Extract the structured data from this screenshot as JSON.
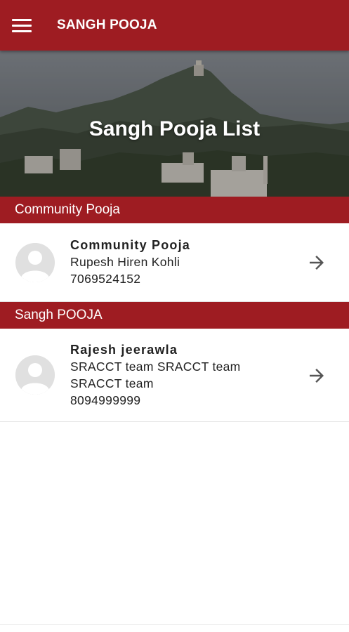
{
  "appbar": {
    "title": "SANGH POOJA",
    "menu_icon": "hamburger-menu-icon",
    "color": "#9e1c22"
  },
  "hero": {
    "title": "Sangh Pooja List"
  },
  "sections": [
    {
      "header": "Community Pooja",
      "items": [
        {
          "name": "Community Pooja",
          "lines": [
            "Rupesh Hiren Kohli",
            "7069524152"
          ],
          "avatar_icon": "default-avatar-icon",
          "action_icon": "arrow-right-icon"
        }
      ]
    },
    {
      "header": "Sangh POOJA",
      "items": [
        {
          "name": "Rajesh jeerawla",
          "lines": [
            "SRACCT team SRACCT team",
            "SRACCT team",
            "8094999999"
          ],
          "avatar_icon": "default-avatar-icon",
          "action_icon": "arrow-right-icon"
        }
      ]
    }
  ]
}
